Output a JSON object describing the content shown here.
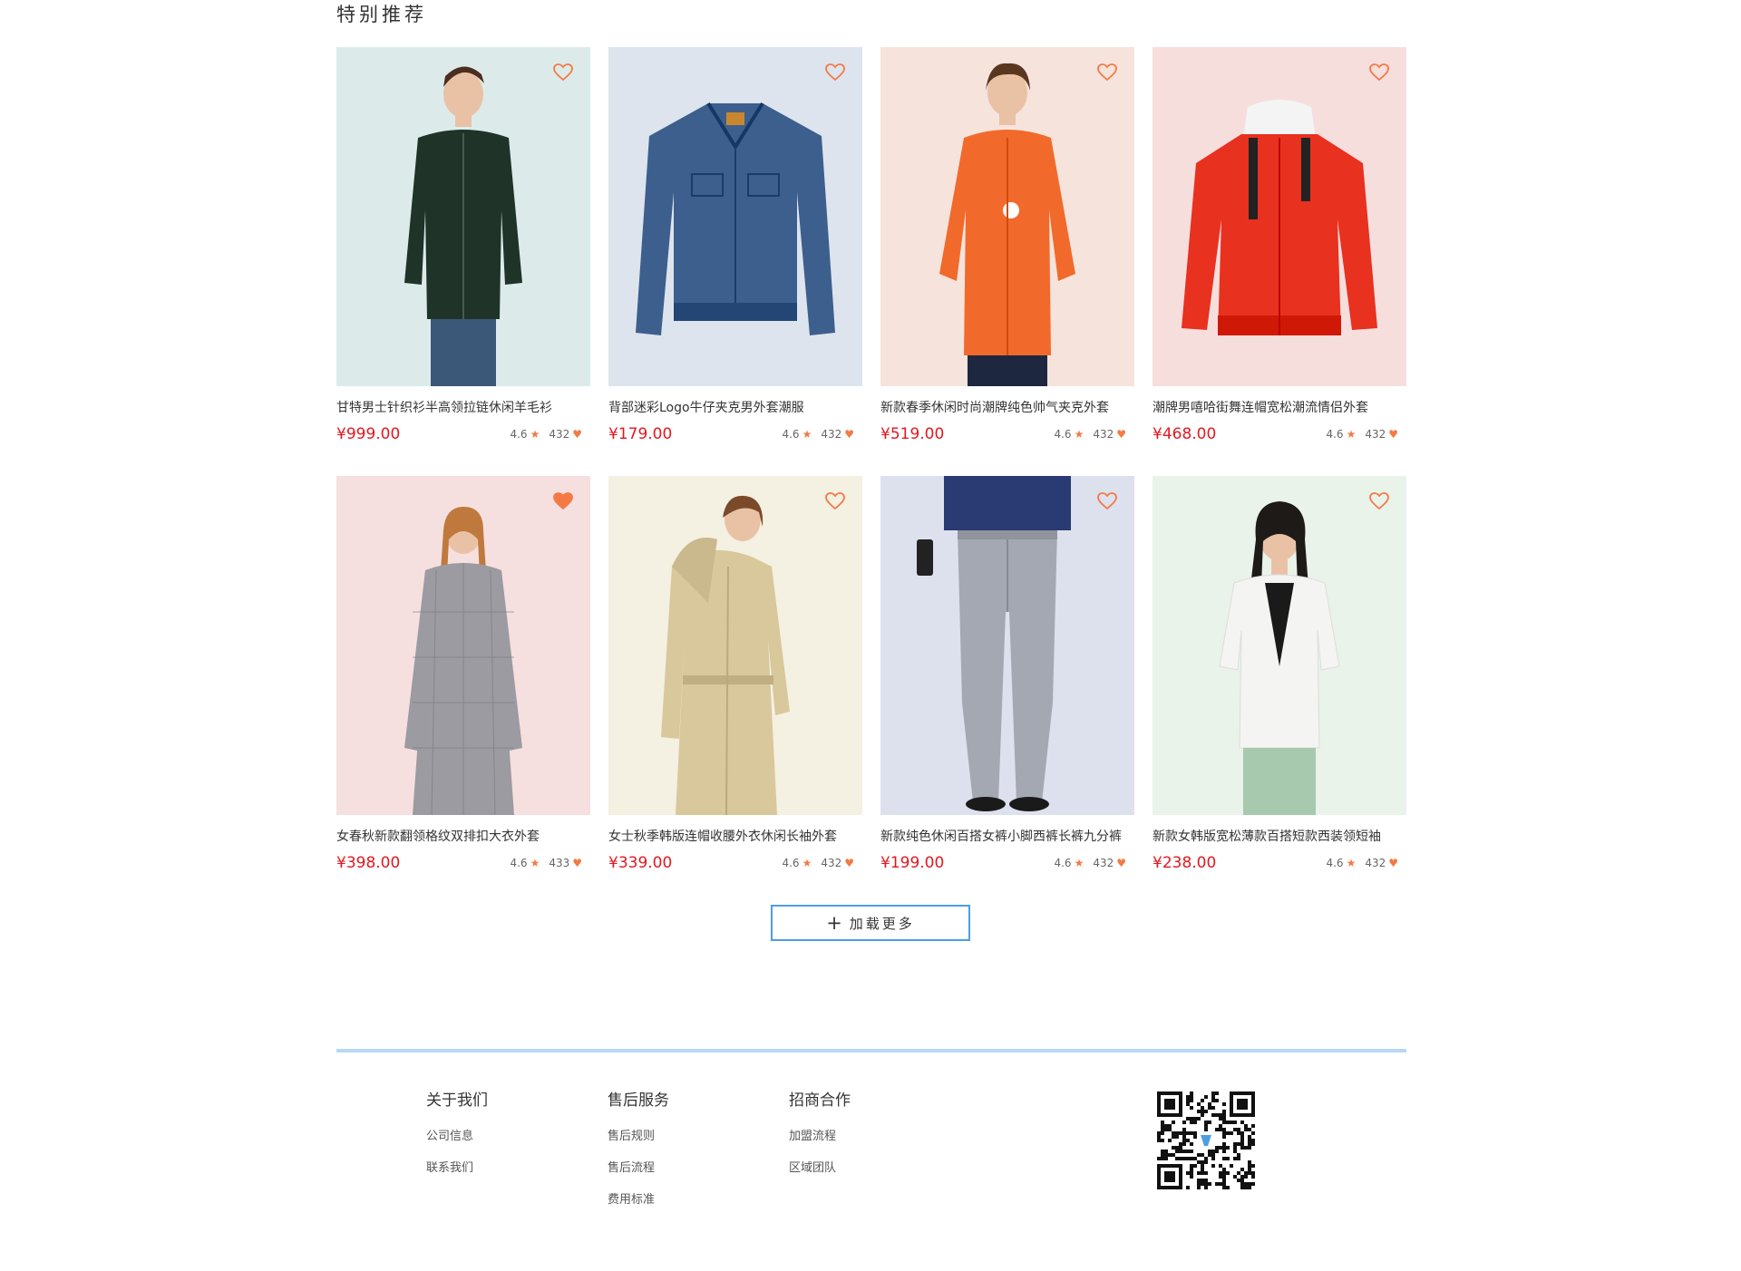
{
  "section": {
    "title": "特别推荐"
  },
  "products": [
    {
      "name": "甘特男士针织衫半高领拉链休闲羊毛衫",
      "price": "¥999.00",
      "rating": "4.6",
      "count": "432",
      "bg": "#dcebea",
      "favorited": false,
      "garment": "dark-green-cardigan",
      "garment_color": "#1f3329"
    },
    {
      "name": "背部迷彩Logo牛仔夹克男外套潮服",
      "price": "¥179.00",
      "rating": "4.6",
      "count": "432",
      "bg": "#dde4ee",
      "favorited": false,
      "garment": "denim-jacket",
      "garment_color": "#3d5f8d"
    },
    {
      "name": "新款春季休闲时尚潮牌纯色帅气夹克外套",
      "price": "¥519.00",
      "rating": "4.6",
      "count": "432",
      "bg": "#f6e3dc",
      "favorited": false,
      "garment": "orange-jacket",
      "garment_color": "#f16a2b"
    },
    {
      "name": "潮牌男嘻哈街舞连帽宽松潮流情侣外套",
      "price": "¥468.00",
      "rating": "4.6",
      "count": "432",
      "bg": "#f6dedd",
      "favorited": false,
      "garment": "red-hooded-jacket",
      "garment_color": "#e8311f"
    },
    {
      "name": "女春秋新款翻领格纹双排扣大衣外套",
      "price": "¥398.00",
      "rating": "4.6",
      "count": "433",
      "bg": "#f6dfdf",
      "favorited": true,
      "garment": "plaid-coat",
      "garment_color": "#9b9ba1"
    },
    {
      "name": "女士秋季韩版连帽收腰外衣休闲长袖外套",
      "price": "¥339.00",
      "rating": "4.6",
      "count": "432",
      "bg": "#f4f0e2",
      "favorited": false,
      "garment": "beige-trench",
      "garment_color": "#d8c89b"
    },
    {
      "name": "新款纯色休闲百搭女裤小脚西裤长裤九分裤",
      "price": "¥199.00",
      "rating": "4.6",
      "count": "432",
      "bg": "#dde1ee",
      "favorited": false,
      "garment": "grey-trousers",
      "garment_color": "#a4a8b3"
    },
    {
      "name": "新款女韩版宽松薄款百搭短款西装领短袖",
      "price": "¥238.00",
      "rating": "4.6",
      "count": "432",
      "bg": "#e9f3e9",
      "favorited": false,
      "garment": "white-blazer",
      "garment_color": "#f4f4f2"
    }
  ],
  "load_more": {
    "label": "加载更多"
  },
  "footer": {
    "columns": [
      {
        "title": "关于我们",
        "links": [
          "公司信息",
          "联系我们"
        ]
      },
      {
        "title": "售后服务",
        "links": [
          "售后规则",
          "售后流程",
          "费用标准"
        ]
      },
      {
        "title": "招商合作",
        "links": [
          "加盟流程",
          "区域团队"
        ]
      }
    ],
    "qr_icon": "qr-code"
  },
  "colors": {
    "accent": "#4d9de5",
    "price": "#e4171f",
    "heart": "#f47a45",
    "rule": "#b7d8f7"
  }
}
